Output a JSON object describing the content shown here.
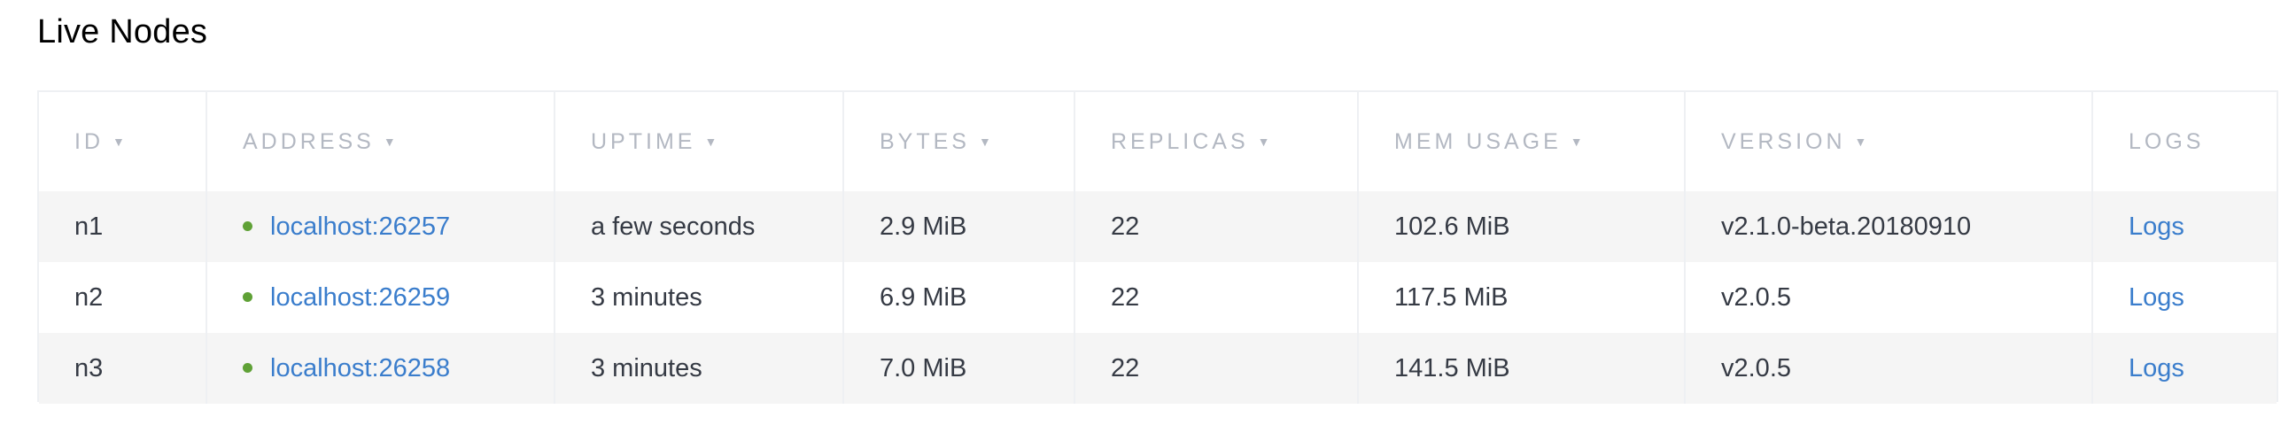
{
  "section": {
    "title": "Live Nodes"
  },
  "table": {
    "columns": [
      {
        "label": "ID",
        "sortable": true
      },
      {
        "label": "ADDRESS",
        "sortable": true
      },
      {
        "label": "UPTIME",
        "sortable": true
      },
      {
        "label": "BYTES",
        "sortable": true
      },
      {
        "label": "REPLICAS",
        "sortable": true
      },
      {
        "label": "MEM USAGE",
        "sortable": true
      },
      {
        "label": "VERSION",
        "sortable": true
      },
      {
        "label": "LOGS",
        "sortable": false
      }
    ],
    "sort_caret": "▼",
    "rows": [
      {
        "id": "n1",
        "address": "localhost:26257",
        "uptime": "a few seconds",
        "bytes": "2.9 MiB",
        "replicas": "22",
        "mem_usage": "102.6 MiB",
        "version": "v2.1.0-beta.20180910",
        "logs": "Logs"
      },
      {
        "id": "n2",
        "address": "localhost:26259",
        "uptime": "3 minutes",
        "bytes": "6.9 MiB",
        "replicas": "22",
        "mem_usage": "117.5 MiB",
        "version": "v2.0.5",
        "logs": "Logs"
      },
      {
        "id": "n3",
        "address": "localhost:26258",
        "uptime": "3 minutes",
        "bytes": "7.0 MiB",
        "replicas": "22",
        "mem_usage": "141.5 MiB",
        "version": "v2.0.5",
        "logs": "Logs"
      }
    ]
  },
  "colors": {
    "status_live": "#5fa136",
    "link": "#3a7dcc",
    "header_text": "#b3b8c2",
    "body_text": "#353a44",
    "stripe": "#f5f5f5"
  }
}
